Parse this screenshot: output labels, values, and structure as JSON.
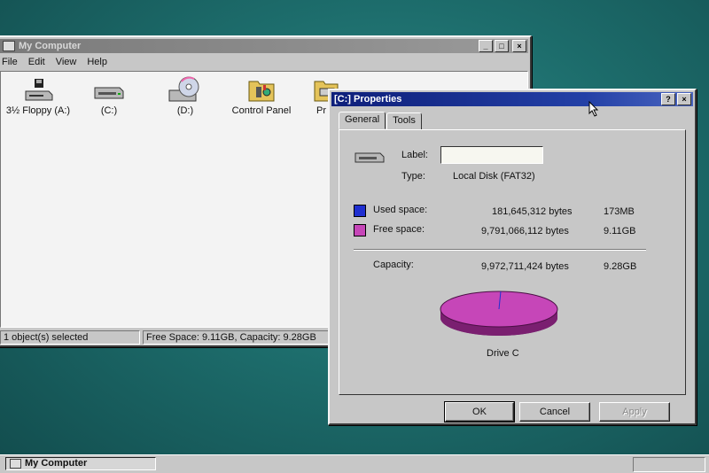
{
  "my_computer": {
    "title": "My Computer",
    "menu": [
      "File",
      "Edit",
      "View",
      "Help"
    ],
    "icons": [
      {
        "label": "3½ Floppy (A:)",
        "icon": "floppy-drive-icon"
      },
      {
        "label": "(C:)",
        "icon": "hard-drive-icon"
      },
      {
        "label": "(D:)",
        "icon": "cd-drive-icon"
      },
      {
        "label": "Control Panel",
        "icon": "control-panel-icon"
      },
      {
        "label": "Pr",
        "icon": "printers-icon"
      }
    ],
    "status": {
      "selected": "1 object(s) selected",
      "space": "Free Space: 9.11GB,  Capacity: 9.28GB"
    },
    "buttons": {
      "minimize": "_",
      "maximize": "□",
      "close": "×"
    }
  },
  "properties": {
    "title": "[C:] Properties",
    "buttons": {
      "help": "?",
      "close": "×"
    },
    "tabs": [
      "General",
      "Tools"
    ],
    "label_caption": "Label:",
    "label_value": "",
    "type_caption": "Type:",
    "type_value": "Local Disk (FAT32)",
    "used": {
      "caption": "Used space:",
      "bytes": "181,645,312 bytes",
      "size": "173MB",
      "color": "#1f2fd0"
    },
    "free": {
      "caption": "Free space:",
      "bytes": "9,791,066,112 bytes",
      "size": "9.11GB",
      "color": "#c646b8"
    },
    "capacity": {
      "caption": "Capacity:",
      "bytes": "9,972,711,424 bytes",
      "size": "9.28GB"
    },
    "drive_caption": "Drive C",
    "ok": "OK",
    "cancel": "Cancel",
    "apply": "Apply"
  },
  "taskbar": {
    "task": "My Computer"
  }
}
